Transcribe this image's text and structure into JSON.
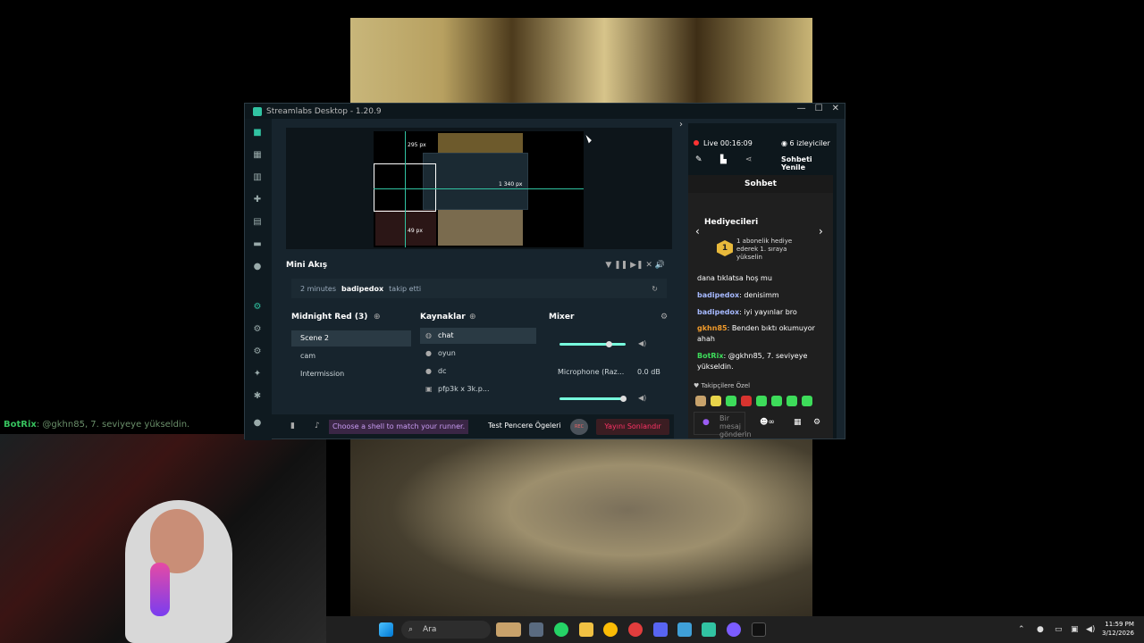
{
  "window": {
    "title": "Streamlabs Desktop - 1.20.9",
    "minimize": "—",
    "maximize": "☐",
    "close": "✕"
  },
  "preview": {
    "label_top": "295 px",
    "label_mid": "1 340 px",
    "label_bottom": "49 px"
  },
  "mini_feed": {
    "title": "Mini Akış",
    "time": "2 minutes",
    "user": "badipedox",
    "action": "takip etti"
  },
  "scenes": {
    "title": "Midnight Red (3)",
    "items": [
      "Scene 2",
      "cam",
      "Intermission"
    ]
  },
  "sources": {
    "title": "Kaynaklar",
    "items": [
      "chat",
      "oyun",
      "dc",
      "pfp3k x 3k.p..."
    ]
  },
  "mixer": {
    "title": "Mixer",
    "device": "Microphone (Raz...",
    "db": "0.0 dB"
  },
  "bottom": {
    "shell_banner": "Choose a shell to match your runner.",
    "test_button": "Test Pencere Ögeleri",
    "rec": "REC",
    "end_button": "Yayını Sonlandır"
  },
  "chat_panel": {
    "live": "Live 00:16:09",
    "viewers": "6 izleyiciler",
    "refresh": "Sohbeti Yenile",
    "title": "Sohbet",
    "gifters_title": "Hediyecileri",
    "gift_badge": "1",
    "gift_text": "1 abonelik hediye ederek 1. sıraya yükselin",
    "messages": [
      {
        "user": "",
        "text": "dana tıklatsa hoş mu"
      },
      {
        "user": "badipedox",
        "text": ": denisimm"
      },
      {
        "user": "badipedox",
        "text": ": iyi yayınlar bro"
      },
      {
        "user": "gkhn85",
        "text": ": Benden bıktı okumuyor ahah"
      },
      {
        "user": "BotRix",
        "text": ": @gkhn85, 7. seviyeye yükseldin."
      }
    ],
    "follower_label": "♥ Takipçilere Özel",
    "input_placeholder": "Bir mesaj gönderin"
  },
  "overlay_chat": {
    "user": "BotRix",
    "text": ": @gkhn85, 7. seviyeye yükseldin."
  },
  "taskbar": {
    "search": "Ara",
    "time": "11:59 PM",
    "date": "3/12/2026"
  },
  "colors": {
    "accent": "#31c3a2",
    "live": "#ff3333",
    "end_button": "#ff3366",
    "shell_banner": "#c99cf3"
  }
}
